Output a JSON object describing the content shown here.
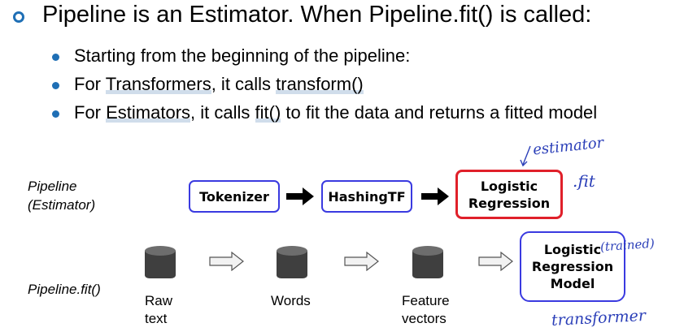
{
  "title": "Pipeline is an Estimator. When Pipeline.fit() is called:",
  "bullets": [
    {
      "parts": [
        "Starting from the beginning of the pipeline:"
      ]
    },
    {
      "parts": [
        "For ",
        "Transformers",
        ", it calls ",
        "transform()"
      ]
    },
    {
      "parts": [
        "For ",
        "Estimators",
        ", it calls ",
        "fit()",
        " to fit the data and returns a fitted model"
      ]
    }
  ],
  "labels": {
    "pipeline": "Pipeline",
    "estimator": "(Estimator)",
    "pipeline_fit": "Pipeline.fit()"
  },
  "stages": {
    "tokenizer": "Tokenizer",
    "hashingtf": "HashingTF",
    "logistic_line1": "Logistic",
    "logistic_line2": "Regression"
  },
  "model": {
    "line1": "Logistic",
    "line2": "Regression",
    "line3": "Model"
  },
  "data_captions": {
    "raw_line1": "Raw",
    "raw_line2": "text",
    "words": "Words",
    "feature_line1": "Feature",
    "feature_line2": "vectors"
  },
  "handwritten": {
    "estimator": "estimator",
    "fit": ".fit",
    "trained": "(trained)",
    "transformer": "transformer"
  },
  "colors": {
    "bullet_blue": "#1f6fb5",
    "box_blue": "#3a3ae0",
    "box_red": "#e0202a",
    "ink_blue": "#2b3fb8"
  }
}
